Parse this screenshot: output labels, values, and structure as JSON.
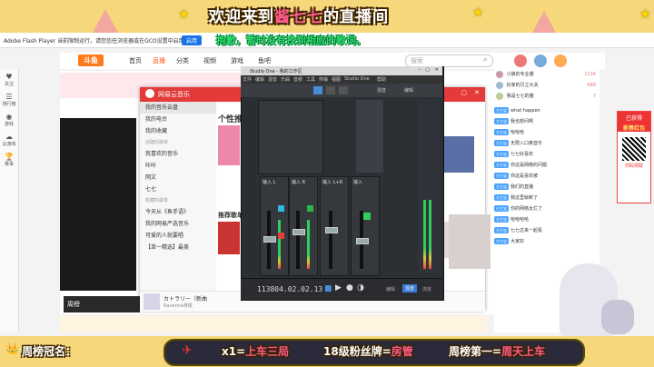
{
  "banner": {
    "title_a": "欢迎来到",
    "title_hl": "酱七七",
    "title_b": "的直播间"
  },
  "lyric": "抱歉，暂时没有找到相应的歌词。",
  "flash_bar": {
    "text": "Adobe Flash Player 当前限制运行。请您信任浏览器或在GCO设置中启用(点击)",
    "button": "启用"
  },
  "site_nav": {
    "logo": "斗鱼",
    "items": [
      "首页",
      "直播",
      "分类",
      "视频",
      "游戏",
      "鱼吧"
    ],
    "search_placeholder": "搜索"
  },
  "left_sidebar": [
    "关注",
    "排行榜",
    "游戏",
    "云游戏",
    "赛事"
  ],
  "netease": {
    "app_name": "网易云音乐",
    "side_items": [
      "我的音乐云盘",
      "我的电台",
      "我的收藏"
    ],
    "section_created": "创建的歌单",
    "created_items": [
      "我喜欢的音乐",
      "咔咔",
      "网文",
      "七七"
    ],
    "section_fav": "收藏的歌单",
    "fav_items": [
      "今天从《鱼手语》",
      "我的网易严选音乐",
      "可爱的人就要唱",
      "【单一精选】最美"
    ],
    "main_heading": "个性推荐",
    "recommend": "推荐歌单",
    "player_song": "カトラリー（新曲",
    "player_artist": "Ravenna林俊"
  },
  "studio": {
    "title": "Studio One - 我的工作区",
    "menu": [
      "文件",
      "编辑",
      "混音",
      "乐曲",
      "音频",
      "工具",
      "传输",
      "视图",
      "Studio One",
      "帮助"
    ],
    "toolbar_labels": [
      "混音",
      "编辑"
    ],
    "channel_label": "输入",
    "channel_names": [
      "输入 L",
      "输入 R",
      "输入 L+R",
      "输入"
    ],
    "counter": "113804.02.02.13",
    "view_tabs": [
      "编辑",
      "混音",
      "浏览"
    ]
  },
  "chat": {
    "top_users": [
      {
        "name": "小狼的专业猫",
        "value": "1134"
      },
      {
        "name": "好家的贝立大关",
        "value": "688"
      },
      {
        "name": "我是七七的猫",
        "value": "7"
      }
    ],
    "messages": [
      {
        "badge": "七七宝",
        "user": "宝",
        "text": "what happen"
      },
      {
        "badge": "七七宝",
        "user": "",
        "text": "我也想问啊"
      },
      {
        "badge": "七七宝",
        "user": "",
        "text": "哈哈哈"
      },
      {
        "badge": "七七宝",
        "user": "",
        "text": "无限入口离音乐"
      },
      {
        "badge": "七七宝",
        "user": "",
        "text": "七七好喜欢"
      },
      {
        "badge": "七七宝",
        "user": "",
        "text": "你这是网络的问题"
      },
      {
        "badge": "七七宝",
        "user": "",
        "text": "你这是喜欢被"
      },
      {
        "badge": "七七宝",
        "user": "",
        "text": "我们的直播"
      },
      {
        "badge": "七七宝",
        "user": "",
        "text": "我这里就断了"
      },
      {
        "badge": "七七宝",
        "user": "",
        "text": "你的网络太烂了"
      },
      {
        "badge": "七七宝",
        "user": "",
        "text": "哈哈哈哈"
      },
      {
        "badge": "七七宝",
        "user": "",
        "text": "七七过来一起看"
      },
      {
        "badge": "七七宝",
        "user": "",
        "text": "大家好"
      }
    ]
  },
  "ad": {
    "line1": "已获得",
    "line2": "新春红包",
    "line3": "扫码领取"
  },
  "bottom": {
    "label": "周榜冠名：",
    "item1_pre": "x1=",
    "item1_hl": "上车三局",
    "item2_pre": "18级粉丝牌=",
    "item2_hl": "房管",
    "item3_pre": "周榜第一=",
    "item3_hl": "周天上车"
  },
  "colors": {
    "banner_bg": "#f6d77a",
    "netease_red": "#e33a3a",
    "lyric_green": "#2ee06a",
    "studio_bg": "#2c2f33",
    "accent_pink": "#ff5a8a"
  }
}
